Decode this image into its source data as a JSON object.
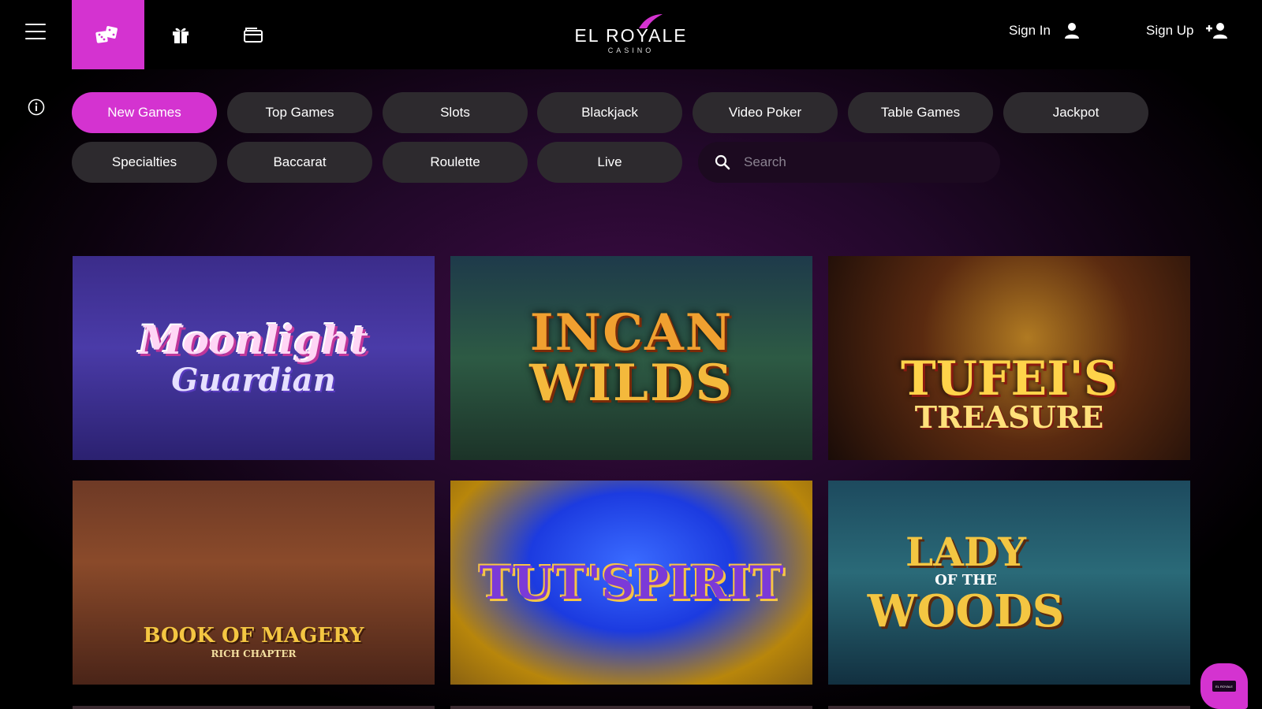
{
  "header": {
    "logo_main": "EL ROYALE",
    "logo_sub": "CASINO",
    "sign_in": "Sign In",
    "sign_up": "Sign Up"
  },
  "categories": [
    {
      "label": "New Games",
      "active": true
    },
    {
      "label": "Top Games"
    },
    {
      "label": "Slots"
    },
    {
      "label": "Blackjack"
    },
    {
      "label": "Video Poker"
    },
    {
      "label": "Table Games"
    },
    {
      "label": "Jackpot"
    },
    {
      "label": "Specialties"
    },
    {
      "label": "Baccarat"
    },
    {
      "label": "Roulette"
    },
    {
      "label": "Live"
    }
  ],
  "search": {
    "placeholder": "Search"
  },
  "games": [
    {
      "title": "Moonlight",
      "subtitle": "Guardian"
    },
    {
      "title": "INCAN",
      "subtitle": "WILDS"
    },
    {
      "title": "TUFEI'S",
      "subtitle": "TREASURE"
    },
    {
      "title": "BOOK OF MAGERY",
      "subtitle": "RICH CHAPTER"
    },
    {
      "title": "TUT'SPIRIT",
      "subtitle": ""
    },
    {
      "title": "LADY",
      "subtitle": "OF THE",
      "subtitle2": "WOODS"
    }
  ],
  "chat": {
    "label": "EL ROYALE"
  },
  "colors": {
    "accent": "#d433d0",
    "pill": "#2d2a2e"
  }
}
